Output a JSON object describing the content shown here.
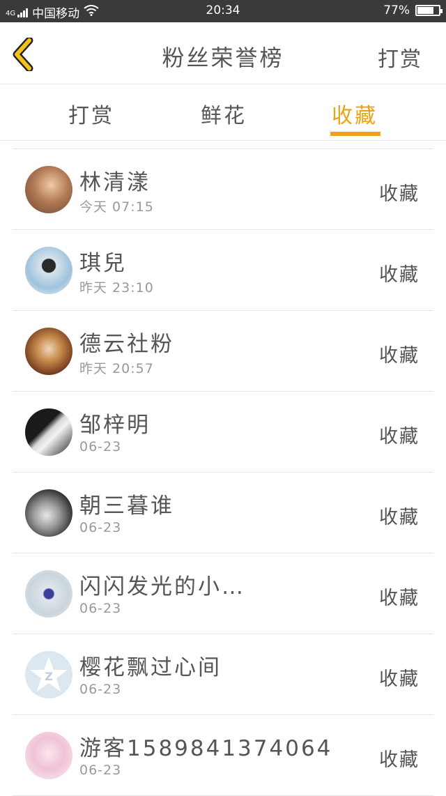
{
  "status_bar": {
    "signal": "4G",
    "carrier": "中国移动",
    "time": "20:34",
    "battery": "77%",
    "battery_level": 0.77
  },
  "header": {
    "title": "粉丝荣誉榜",
    "action": "打赏",
    "back_icon": "chevron-left-icon",
    "back_icon_color": "#f2c21b"
  },
  "tabs": [
    {
      "label": "打赏",
      "active": false
    },
    {
      "label": "鲜花",
      "active": false
    },
    {
      "label": "收藏",
      "active": true
    }
  ],
  "accent_color": "#f0a21b",
  "fans": [
    {
      "name": "林清漾",
      "time": "今天 07:15",
      "action": "收藏"
    },
    {
      "name": "琪兒",
      "time": "昨天 23:10",
      "action": "收藏"
    },
    {
      "name": "德云社粉",
      "time": "昨天 20:57",
      "action": "收藏"
    },
    {
      "name": "邹梓明",
      "time": "06-23",
      "action": "收藏"
    },
    {
      "name": "朝三暮谁",
      "time": "06-23",
      "action": "收藏"
    },
    {
      "name": "闪闪发光的小…",
      "time": "06-23",
      "action": "收藏"
    },
    {
      "name": "樱花飘过心间",
      "time": "06-23",
      "action": "收藏"
    },
    {
      "name": "游客15898413740­64",
      "time": "06-23",
      "action": "收藏"
    }
  ]
}
